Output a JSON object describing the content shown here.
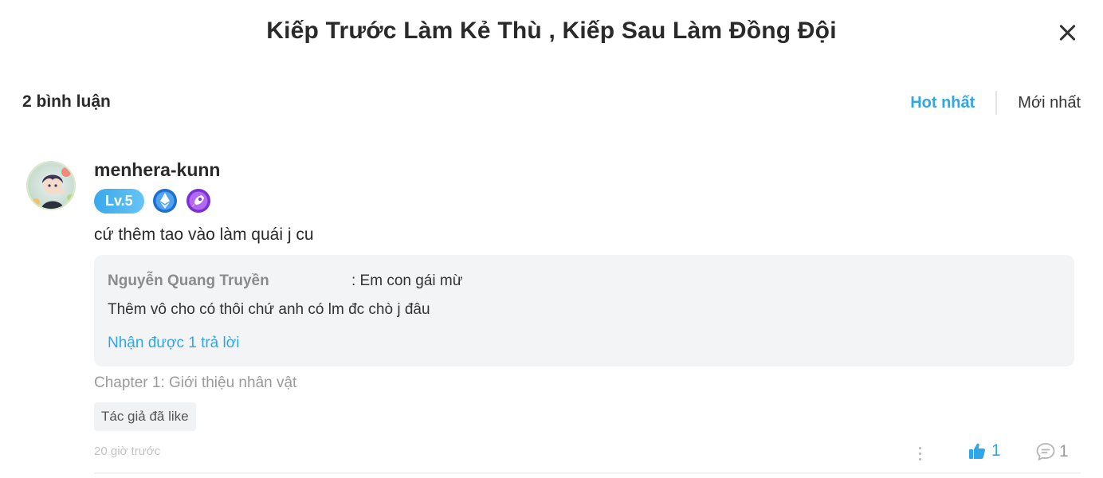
{
  "modal": {
    "title": "Kiếp Trước Làm Kẻ Thù , Kiếp Sau Làm Đồng Đội",
    "close_icon": "close-icon"
  },
  "comments_header": {
    "count_label": "2 bình luận",
    "sort_hot": "Hot nhất",
    "sort_new": "Mới nhất",
    "active_sort_color": "#2fa6e8"
  },
  "comment": {
    "username": "menhera-kunn",
    "level": "Lv.5",
    "badge_icons": [
      "ethereum-medal-icon",
      "purple-rocket-medal-icon"
    ],
    "text": "cứ thêm tao vào làm quái j cu",
    "reply": {
      "author": "Nguyễn Quang Truyền",
      "snippet": ": Em con gái mừ",
      "text": "Thêm vô cho có thôi chứ anh có lm đc chò j đâu",
      "more_label": "Nhận được 1 trả lời"
    },
    "chapter": "Chapter 1: Giới thiệu nhân vật",
    "author_liked": "Tác giả đã like",
    "time": "20 giờ trước",
    "like_count": "1",
    "reply_count": "1"
  },
  "colors": {
    "accent": "#2fa6e8",
    "muted": "#9a9a9a"
  }
}
